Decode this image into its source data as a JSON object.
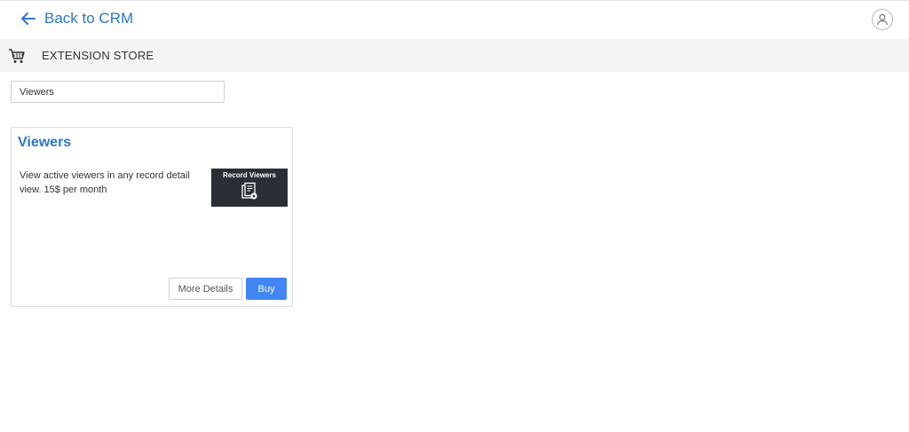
{
  "header": {
    "back_label": "Back to CRM",
    "back_icon": "arrow-left-icon",
    "user_icon": "user-avatar-icon",
    "accent_color": "#2a77c9"
  },
  "section": {
    "icon": "shopping-cart-icon",
    "title": "EXTENSION STORE"
  },
  "search": {
    "value": "Viewers",
    "placeholder": ""
  },
  "results": [
    {
      "title": "Viewers",
      "description": "View active viewers in any record detail view. 15$ per month",
      "thumbnail_label": "Record Viewers",
      "thumbnail_icon": "document-view-icon",
      "more_details_label": "More Details",
      "buy_label": "Buy",
      "buy_color": "#4285f4"
    }
  ]
}
